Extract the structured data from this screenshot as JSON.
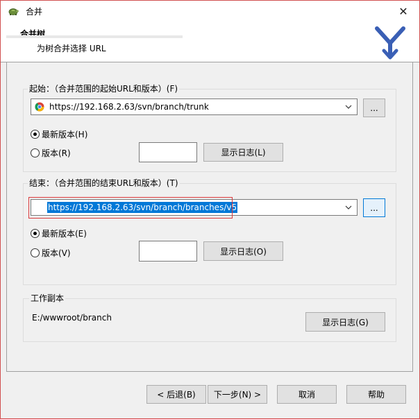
{
  "window": {
    "title": "合并",
    "close_glyph": "✕"
  },
  "header": {
    "title": "合并树",
    "subtitle": "为树合并选择 URL"
  },
  "start_group": {
    "label": "起始：（合并范围的起始URL和版本）(F)",
    "url": "https://192.168.2.63/svn/branch/trunk",
    "browse": "...",
    "head_revision": "最新版本(H)",
    "revision": "版本(R)",
    "revision_value": "",
    "show_log": "显示日志(L)",
    "selected": "head_revision"
  },
  "end_group": {
    "label": "结束：（合并范围的结束URL和版本）(T)",
    "url": "https://192.168.2.63/svn/branch/branches/v5",
    "browse": "...",
    "head_revision": "最新版本(E)",
    "revision": "版本(V)",
    "revision_value": "",
    "show_log": "显示日志(O)",
    "selected": "head_revision"
  },
  "working_copy": {
    "label": "工作副本",
    "path": "E:/wwwroot/branch",
    "show_log": "显示日志(G)"
  },
  "footer": {
    "back": "< 后退(B)",
    "next": "下一步(N) >",
    "cancel": "取消",
    "help": "帮助"
  },
  "icons": {
    "title": "tortoise-icon",
    "logo": "svn-merge-logo",
    "favicon": "chrome-icon",
    "dropdown": "chevron-down-icon"
  },
  "colors": {
    "accent": "#0078d7",
    "highlight_frame": "#d9383a",
    "logo_blue": "#3a5fb5"
  }
}
